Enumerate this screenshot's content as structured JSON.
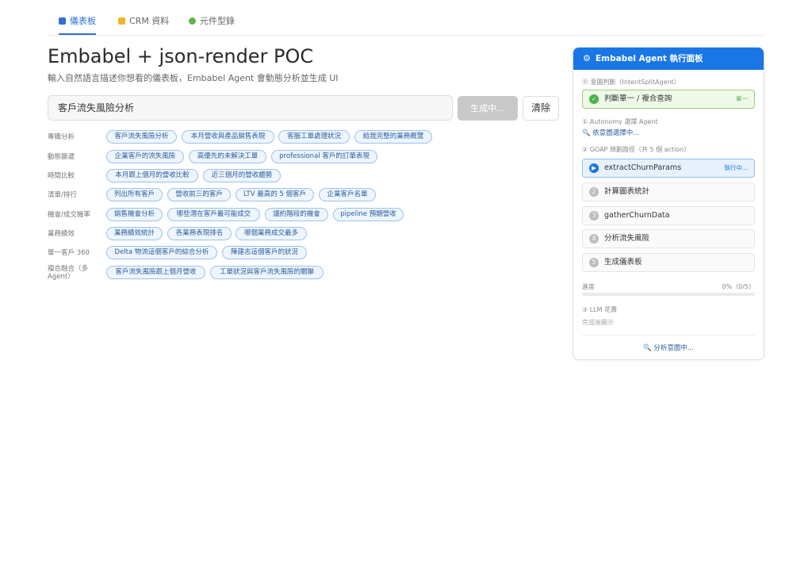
{
  "tabs": [
    {
      "label": "儀表板",
      "icon": "bar-chart-icon",
      "color": "#2f6fd6"
    },
    {
      "label": "CRM 資料",
      "icon": "folder-icon",
      "color": "#f0b429"
    },
    {
      "label": "元件型錄",
      "icon": "puzzle-icon",
      "color": "#62b347"
    }
  ],
  "header": {
    "title": "Embabel + json-render POC",
    "subtitle": "輸入自然語言描述你想看的儀表板，Embabel Agent 會動態分析並生成 UI"
  },
  "query": {
    "value": "客戶流失風險分析",
    "generate_label": "生成中...",
    "clear_label": "清除"
  },
  "suggestions": [
    {
      "category": "專職分析",
      "chips": [
        "客戶流失風險分析",
        "本月營收與產品銷售表現",
        "客服工單處理狀況",
        "給我完整的業務概覽"
      ]
    },
    {
      "category": "動態篩選",
      "chips": [
        "企業客戶的流失風險",
        "高優先的未解決工單",
        "professional 客戶的訂單表現"
      ]
    },
    {
      "category": "時間比較",
      "chips": [
        "本月跟上個月的營收比較",
        "近三個月的營收趨勢"
      ]
    },
    {
      "category": "清單/排行",
      "chips": [
        "列出所有客戶",
        "營收前三的客戶",
        "LTV 最高的 5 個客戶",
        "企業客戶名單"
      ]
    },
    {
      "category": "機會/成交機率",
      "chips": [
        "銷售機會分析",
        "哪些潛在客戶最可能成交",
        "議約階段的機會",
        "pipeline 預期營收"
      ]
    },
    {
      "category": "業務績效",
      "chips": [
        "業務績效統計",
        "各業務表現排名",
        "哪個業務成交最多"
      ]
    },
    {
      "category": "單一客戶 360",
      "chips": [
        "Delta 物流這個客戶的綜合分析",
        "陳建志這個客戶的狀況"
      ]
    },
    {
      "category": "複合融合（多 Agent）",
      "chips": [
        "客戶流失風險跟上個月營收",
        "工單狀況與客戶流失風險的關聯"
      ]
    }
  ],
  "panel": {
    "title": "Embabel Agent 執行面板",
    "intent_section": "⓪ 意圖判斷（IntentSplitAgent）",
    "intent_box": {
      "label": "判斷單一 / 複合查詢",
      "status": "單一"
    },
    "autonomy_section": "① Autonomy 選擇 Agent",
    "autonomy_link": "依意圖選擇中...",
    "goap_section": "② GOAP 規劃路徑（共 5 個 action）",
    "steps": [
      {
        "num": "▶",
        "label": "extractChurnParams",
        "status": "執行中...",
        "state": "active"
      },
      {
        "num": "2",
        "label": "計算圖表統計",
        "status": "",
        "state": "pending"
      },
      {
        "num": "3",
        "label": "gatherChurnData",
        "status": "",
        "state": "pending"
      },
      {
        "num": "4",
        "label": "分析流失風險",
        "status": "",
        "state": "pending"
      },
      {
        "num": "5",
        "label": "生成儀表板",
        "status": "",
        "state": "pending"
      }
    ],
    "progress_label": "進度",
    "progress_text": "0%（0/5）",
    "progress_value": 0,
    "llm_section": "③ LLM 花費",
    "llm_note": "完成後顯示",
    "footer_status": "分析意圖中..."
  }
}
